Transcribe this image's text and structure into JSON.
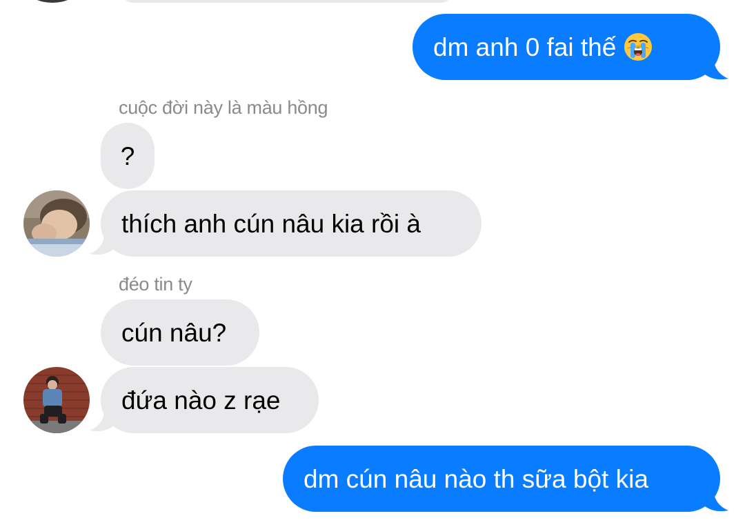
{
  "conversation": {
    "messages": [
      {
        "type": "outgoing",
        "text": "dm anh 0 fai thế",
        "emoji": "loudly-crying-face"
      },
      {
        "type": "sender",
        "text": "cuộc đời này là màu hồng"
      },
      {
        "type": "incoming",
        "text": "?"
      },
      {
        "type": "incoming",
        "text": "thích anh cún nâu kia rồi à",
        "avatar": "avatar-1"
      },
      {
        "type": "sender",
        "text": "đéo tin ty"
      },
      {
        "type": "incoming",
        "text": "cún nâu?"
      },
      {
        "type": "incoming",
        "text": "đứa nào z rạe",
        "avatar": "avatar-2"
      },
      {
        "type": "outgoing",
        "text": "dm cún nâu nào th sữa bột kia"
      }
    ]
  },
  "colors": {
    "outgoing_bubble": "#0a7cff",
    "incoming_bubble": "#e9e9eb",
    "sender_name": "#8a8a8e"
  }
}
